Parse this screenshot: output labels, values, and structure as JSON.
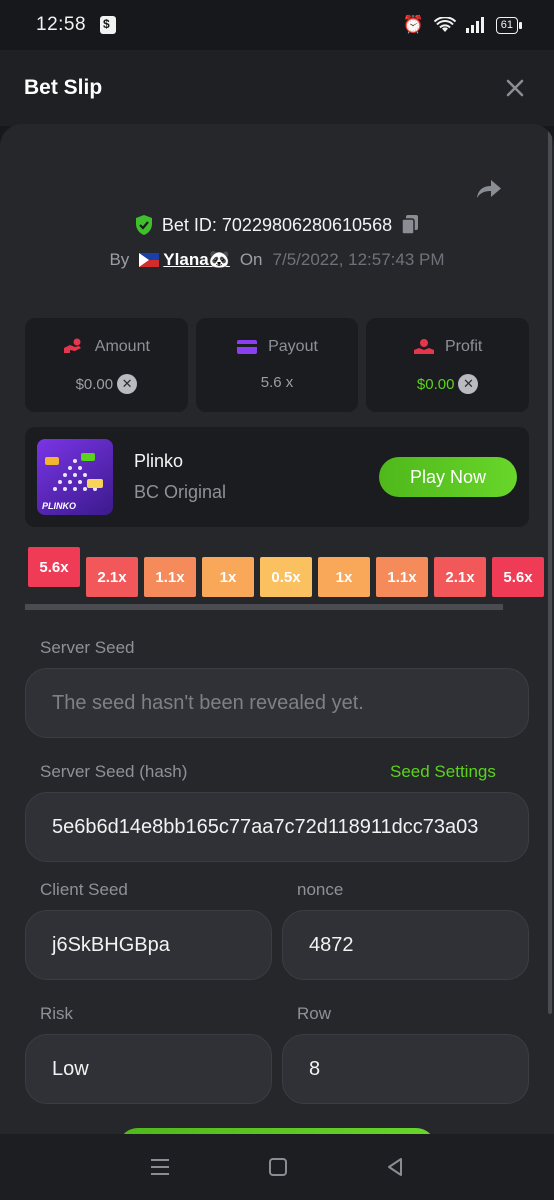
{
  "status": {
    "time": "12:58",
    "battery": "61"
  },
  "header": {
    "title": "Bet Slip"
  },
  "bet": {
    "id_label": "Bet ID: 70229806280610568",
    "by": "By",
    "user": "Ylana🐼",
    "on": "On",
    "date": "7/5/2022, 12:57:43 PM"
  },
  "stats": {
    "amount": {
      "label": "Amount",
      "value": "$0.00"
    },
    "payout": {
      "label": "Payout",
      "value": "5.6 x"
    },
    "profit": {
      "label": "Profit",
      "value": "$0.00"
    }
  },
  "game": {
    "name": "Plinko",
    "provider": "BC Original",
    "play": "Play Now",
    "thumb_label": "PLINKO"
  },
  "multipliers": [
    "5.6x",
    "2.1x",
    "1.1x",
    "1x",
    "0.5x",
    "1x",
    "1.1x",
    "2.1x",
    "5.6x"
  ],
  "multiplier_colors": [
    "#ef3b55",
    "#f2575a",
    "#f58a5a",
    "#f9a758",
    "#fbc060",
    "#f9a758",
    "#f58a5a",
    "#f2575a",
    "#ef3b55"
  ],
  "form": {
    "server_seed_label": "Server Seed",
    "server_seed_placeholder": "The seed hasn't been revealed yet.",
    "hash_label": "Server Seed (hash)",
    "seed_settings": "Seed Settings",
    "hash_value": "5e6b6d14e8bb165c77aa7c72d118911dcc73a03",
    "client_seed_label": "Client Seed",
    "client_seed_value": "j6SkBHGBpa",
    "nonce_label": "nonce",
    "nonce_value": "4872",
    "risk_label": "Risk",
    "risk_value": "Low",
    "row_label": "Row",
    "row_value": "8"
  },
  "colors": {
    "accent_green": "#5cd31b",
    "background": "#25272b"
  }
}
